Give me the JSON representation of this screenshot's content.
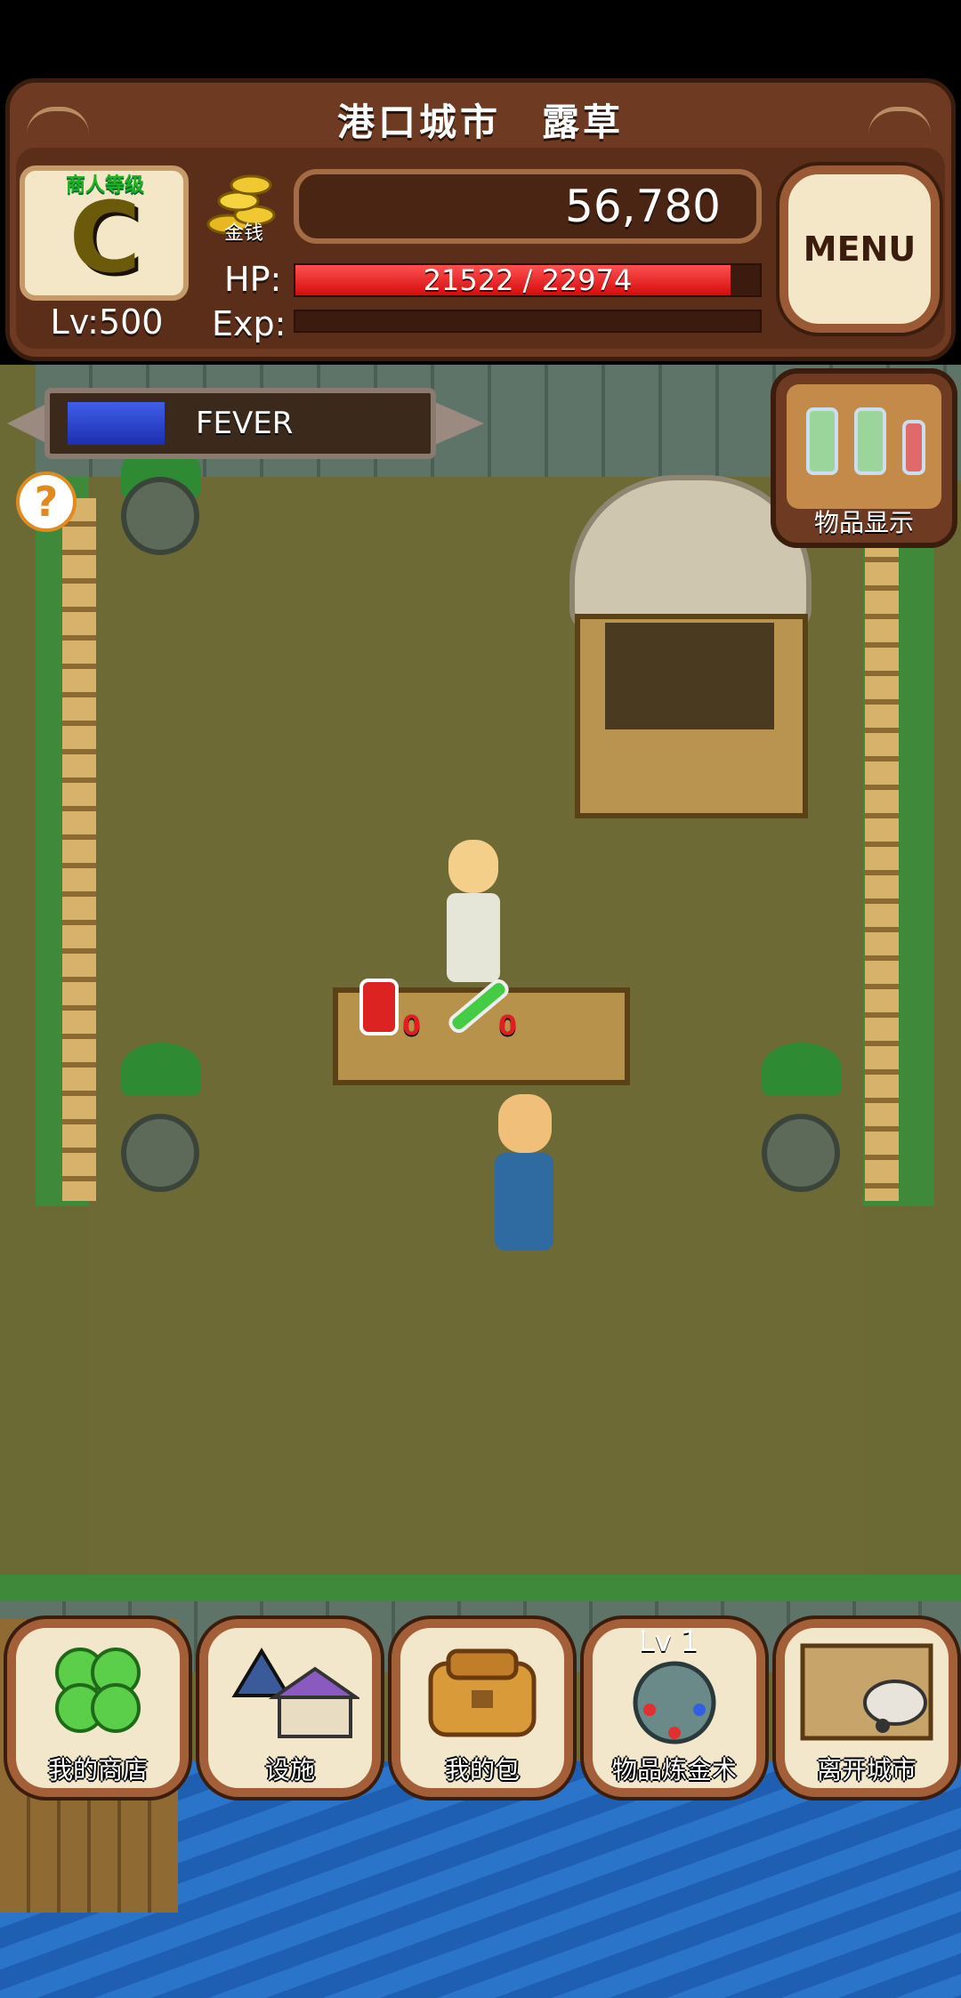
{
  "header": {
    "location_title": "港口城市　露草",
    "rank_label": "商人等级",
    "rank_letter": "C",
    "level": "Lv:500",
    "gold_label": "金钱",
    "money": "56,780",
    "hp_label": "HP:",
    "hp_text": "21522 / 22974",
    "hp_fraction": 0.937,
    "exp_label": "Exp:",
    "exp_fraction": 0.0,
    "menu_label": "MENU"
  },
  "fever": {
    "label": "FEVER",
    "fraction": 0.28
  },
  "help": {
    "icon_text": "?"
  },
  "item_display": {
    "label": "物品显示"
  },
  "counter": {
    "red_potion_count": "0",
    "green_potion_count": "0"
  },
  "bottom_nav": {
    "my_shop": "我的商店",
    "facilities": "设施",
    "my_bag": "我的包",
    "alchemy": "物品炼金术",
    "alchemy_level": "Lv 1",
    "leave_town": "离开城市"
  },
  "colors": {
    "frame_brown": "#6e3b22",
    "hp_red": "#d40c0c",
    "fever_blue": "#1d2fb0",
    "button_cream": "#f2e7cb"
  }
}
